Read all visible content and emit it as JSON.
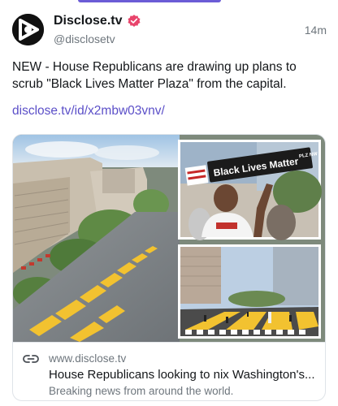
{
  "post": {
    "display_name": "Disclose.tv",
    "handle": "@disclosetv",
    "timestamp": "14m",
    "text": "NEW - House Republicans are drawing up plans to scrub \"Black Lives Matter Plaza\" from the capital.",
    "link": "disclose.tv/id/x2mbw03vnv/"
  },
  "card": {
    "image_sign_text": "Black Lives Matter",
    "image_sign_small": "PLZ NW",
    "domain": "www.disclose.tv",
    "title": "House Republicans looking to nix Washington's...",
    "description": "Breaking news from around the world."
  },
  "colors": {
    "accent": "#5b4fc8",
    "verified_badge": "#e8446b",
    "street_paint": "#f2c230"
  },
  "icons": {
    "avatar": "play-logo-icon",
    "verified": "verified-badge-icon",
    "link": "link-icon"
  }
}
